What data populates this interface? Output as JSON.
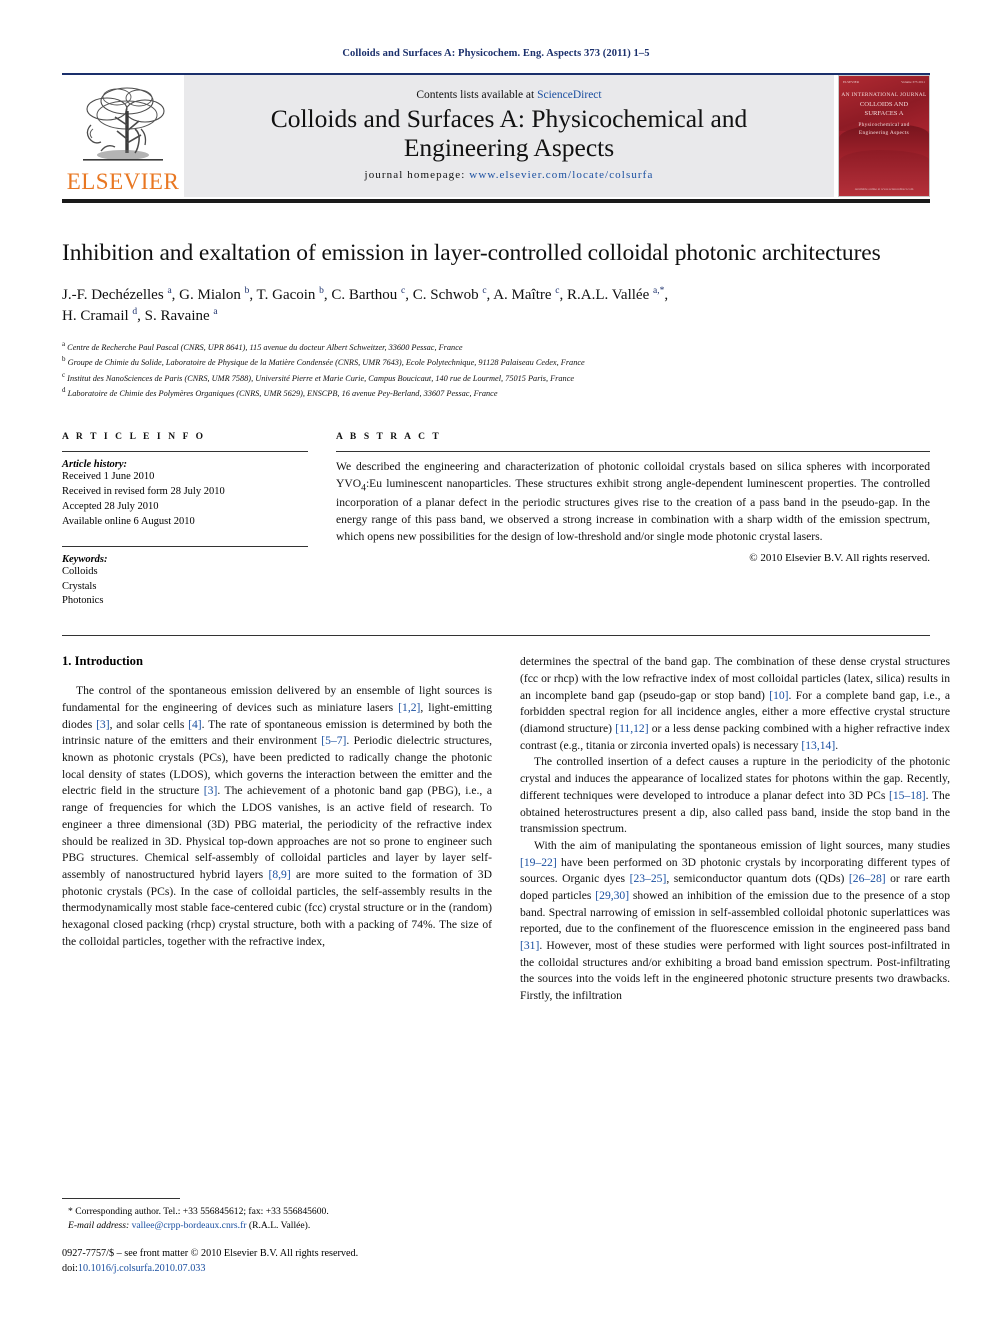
{
  "running_head": "Colloids and Surfaces A: Physicochem. Eng. Aspects 373 (2011) 1–5",
  "masthead": {
    "publisher_name": "ELSEVIER",
    "contents_prefix": "Contents lists available at ",
    "contents_link": "ScienceDirect",
    "journal_title_line1": "Colloids and Surfaces A: Physicochemical and",
    "journal_title_line2": "Engineering Aspects",
    "homepage_label": "journal homepage:",
    "homepage_url": "www.elsevier.com/locate/colsurfa",
    "cover": {
      "top_left": "ELSEVIER",
      "top_right": "Volume 373  2011",
      "title_line1": "AN INTERNATIONAL JOURNAL",
      "title_line2": "COLLOIDS AND",
      "title_line3": "SURFACES A",
      "subtitle_line1": "Physicochemical and",
      "subtitle_line2": "Engineering Aspects",
      "footer": "Available online at www.sciencedirect.com"
    }
  },
  "article": {
    "title": "Inhibition and exaltation of emission in layer-controlled colloidal photonic architectures",
    "authors_line1": "J.-F. Dechézelles <sup>a</sup>, G. Mialon <sup>b</sup>, T. Gacoin <sup>b</sup>, C. Barthou <sup>c</sup>, C. Schwob <sup>c</sup>, A. Maître <sup>c</sup>, R.A.L. Vallée <sup>a,</sup><sup>*</sup>,",
    "authors_line2": "H. Cramail <sup>d</sup>, S. Ravaine <sup>a</sup>",
    "affiliations": [
      "<sup>a</sup> Centre de Recherche Paul Pascal (CNRS, UPR 8641), 115 avenue du docteur Albert Schweitzer, 33600 Pessac, France",
      "<sup>b</sup> Groupe de Chimie du Solide, Laboratoire de Physique de la Matière Condensée (CNRS, UMR 7643), Ecole Polytechnique, 91128 Palaiseau Cedex, France",
      "<sup>c</sup> Institut des NanoSciences de Paris (CNRS, UMR 7588), Université Pierre et Marie Curie, Campus Boucicaut, 140 rue de Lourmel, 75015 Paris, France",
      "<sup>d</sup> Laboratoire de Chimie des Polymères Organiques (CNRS, UMR 5629), ENSCPB, 16 avenue Pey-Berland, 33607 Pessac, France"
    ]
  },
  "article_info": {
    "heading": "A R T I C L E    I N F O",
    "history_label": "Article history:",
    "history": [
      "Received 1 June 2010",
      "Received in revised form 28 July 2010",
      "Accepted 28 July 2010",
      "Available online 6 August 2010"
    ],
    "keywords_label": "Keywords:",
    "keywords": [
      "Colloids",
      "Crystals",
      "Photonics"
    ]
  },
  "abstract": {
    "heading": "A B S T R A C T",
    "text": "We described the engineering and characterization of photonic colloidal crystals based on silica spheres with incorporated YVO4:Eu luminescent nanoparticles. These structures exhibit strong angle-dependent luminescent properties. The controlled incorporation of a planar defect in the periodic structures gives rise to the creation of a pass band in the pseudo-gap. In the energy range of this pass band, we observed a strong increase in combination with a sharp width of the emission spectrum, which opens new possibilities for the design of low-threshold and/or single mode photonic crystal lasers.",
    "copyright": "© 2010 Elsevier B.V. All rights reserved."
  },
  "body": {
    "section_number_title": "1.  Introduction",
    "left_paragraphs": [
      "The control of the spontaneous emission delivered by an ensemble of light sources is fundamental for the engineering of devices such as miniature lasers [1,2], light-emitting diodes [3], and solar cells [4]. The rate of spontaneous emission is determined by both the intrinsic nature of the emitters and their environment [5–7]. Periodic dielectric structures, known as photonic crystals (PCs), have been predicted to radically change the photonic local density of states (LDOS), which governs the interaction between the emitter and the electric field in the structure [3]. The achievement of a photonic band gap (PBG), i.e., a range of frequencies for which the LDOS vanishes, is an active field of research. To engineer a three dimensional (3D) PBG material, the periodicity of the refractive index should be realized in 3D. Physical top-down approaches are not so prone to engineer such PBG structures. Chemical self-assembly of colloidal particles and layer by layer self-assembly of nanostructured hybrid layers [8,9] are more suited to the formation of 3D photonic crystals (PCs). In the case of colloidal particles, the self-assembly results in the thermodynamically most stable face-centered cubic (fcc) crystal structure or in the (random) hexagonal closed packing (rhcp) crystal structure, both with a packing of 74%. The size of the colloidal particles, together with the refractive index,"
    ],
    "right_paragraphs": [
      "determines the spectral of the band gap. The combination of these dense crystal structures (fcc or rhcp) with the low refractive index of most colloidal particles (latex, silica) results in an incomplete band gap (pseudo-gap or stop band) [10]. For a complete band gap, i.e., a forbidden spectral region for all incidence angles, either a more effective crystal structure (diamond structure) [11,12] or a less dense packing combined with a higher refractive index contrast (e.g., titania or zirconia inverted opals) is necessary [13,14].",
      "The controlled insertion of a defect causes a rupture in the periodicity of the photonic crystal and induces the appearance of localized states for photons within the gap. Recently, different techniques were developed to introduce a planar defect into 3D PCs [15–18]. The obtained heterostructures present a dip, also called pass band, inside the stop band in the transmission spectrum.",
      "With the aim of manipulating the spontaneous emission of light sources, many studies [19–22] have been performed on 3D photonic crystals by incorporating different types of sources. Organic dyes [23–25], semiconductor quantum dots (QDs) [26–28] or rare earth doped particles [29,30] showed an inhibition of the emission due to the presence of a stop band. Spectral narrowing of emission in self-assembled colloidal photonic superlattices was reported, due to the confinement of the fluorescence emission in the engineered pass band [31]. However, most of these studies were performed with light sources post-infiltrated in the colloidal structures and/or exhibiting a broad band emission spectrum. Post-infiltrating the sources into the voids left in the engineered photonic structure presents two drawbacks. Firstly, the infiltration"
    ]
  },
  "footnotes": {
    "corresponding": "* Corresponding author. Tel.: +33 556845612; fax: +33 556845600.",
    "email_label": "E-mail address:",
    "email": "vallee@crpp-bordeaux.cnrs.fr",
    "email_suffix": "(R.A.L. Vallée).",
    "issn_line": "0927-7757/$ – see front matter © 2010 Elsevier B.V. All rights reserved.",
    "doi_label": "doi:",
    "doi": "10.1016/j.colsurfa.2010.07.033"
  },
  "colors": {
    "header_blue": "#1a2f6b",
    "link_blue": "#1a4fa0",
    "elsevier_orange": "#e87722",
    "band_gray": "#e9e9eb",
    "cover_red": "#9d1f2b"
  }
}
